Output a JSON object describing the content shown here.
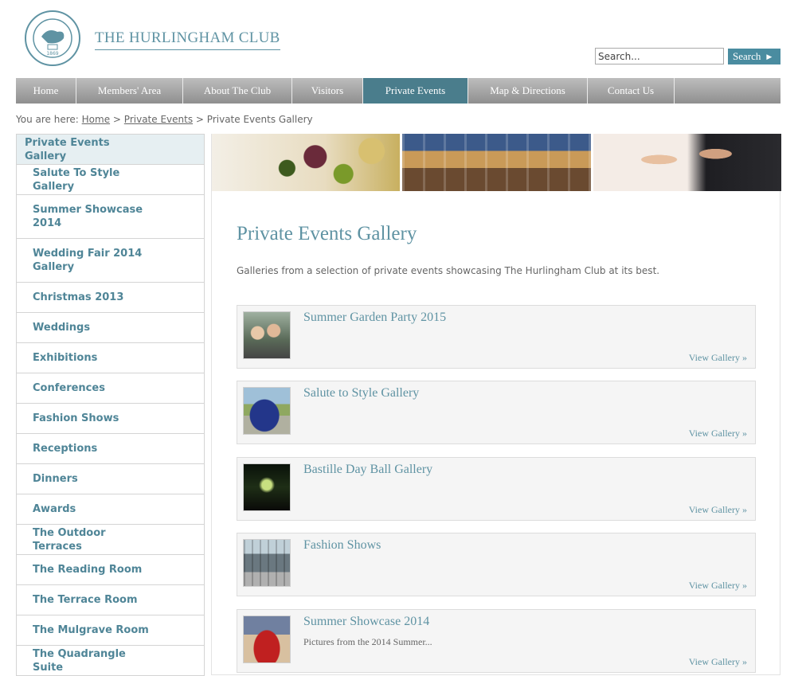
{
  "header": {
    "club_name": "THE HURLINGHAM CLUB",
    "logo_text_top": "THE HURLINGHAM CLUB",
    "logo_year": "1869",
    "search_placeholder": "Search...",
    "search_button": "Search"
  },
  "nav": {
    "items": [
      {
        "label": "Home"
      },
      {
        "label": "Members' Area"
      },
      {
        "label": "About The Club"
      },
      {
        "label": "Visitors"
      },
      {
        "label": "Private Events"
      },
      {
        "label": "Map & Directions"
      },
      {
        "label": "Contact Us"
      }
    ],
    "active_index": 4
  },
  "breadcrumb": {
    "prefix": "You are here:",
    "home": "Home",
    "sep1": ">",
    "section": "Private Events",
    "sep2": ">",
    "current": "Private Events Gallery"
  },
  "sidebar": {
    "items": [
      {
        "label": "Private Events Gallery"
      },
      {
        "label": "Salute To Style Gallery"
      },
      {
        "label": "Summer Showcase 2014"
      },
      {
        "label": "Wedding Fair 2014 Gallery"
      },
      {
        "label": "Christmas 2013"
      },
      {
        "label": "Weddings"
      },
      {
        "label": "Exhibitions"
      },
      {
        "label": "Conferences"
      },
      {
        "label": "Fashion Shows"
      },
      {
        "label": "Receptions"
      },
      {
        "label": "Dinners"
      },
      {
        "label": "Awards"
      },
      {
        "label": "The Outdoor Terraces"
      },
      {
        "label": "The Reading Room"
      },
      {
        "label": "The Terrace Room"
      },
      {
        "label": "The Mulgrave Room"
      },
      {
        "label": "The Quadrangle Suite"
      }
    ]
  },
  "main": {
    "title": "Private Events Gallery",
    "intro": "Galleries from a selection of private events showcasing The Hurlingham Club at its best.",
    "galleries": [
      {
        "title": "Summer Garden Party 2015",
        "desc": "",
        "link": "View Gallery »"
      },
      {
        "title": "Salute to Style Gallery",
        "desc": "",
        "link": "View Gallery »"
      },
      {
        "title": "Bastille Day Ball Gallery",
        "desc": "",
        "link": "View Gallery »"
      },
      {
        "title": "Fashion Shows",
        "desc": "",
        "link": "View Gallery »"
      },
      {
        "title": "Summer Showcase 2014",
        "desc": "Pictures from the 2014 Summer...",
        "link": "View Gallery »"
      }
    ]
  },
  "colors": {
    "accent": "#5f93a3",
    "nav_active": "#4a7d8c",
    "search_button": "#4a8ca0"
  }
}
